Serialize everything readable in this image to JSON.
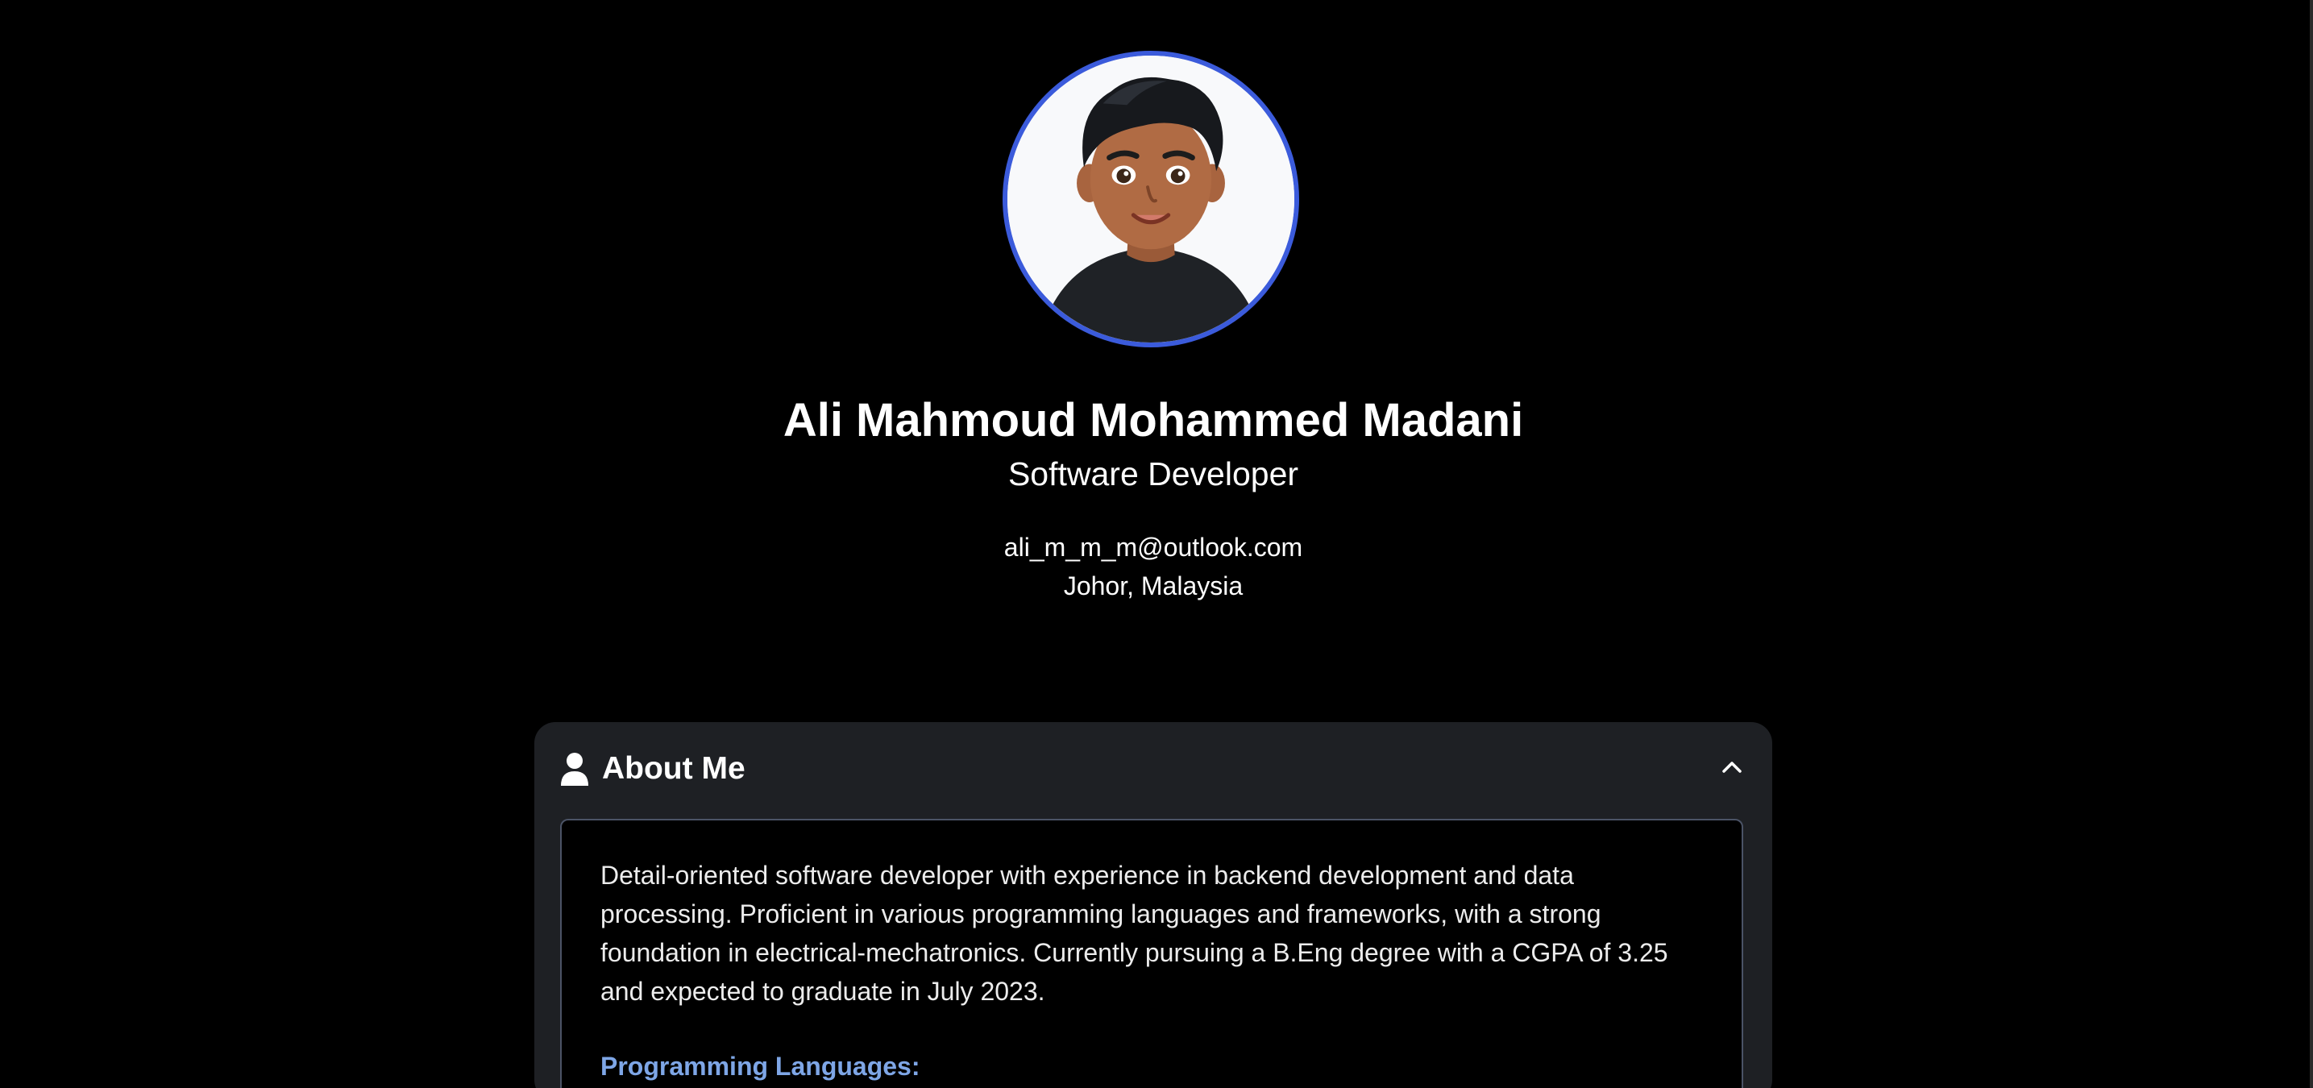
{
  "profile": {
    "name": "Ali Mahmoud Mohammed Madani",
    "title": "Software Developer",
    "email": "ali_m_m_m@outlook.com",
    "location": "Johor, Malaysia",
    "avatar_icon": "developer-avatar-illustration"
  },
  "about_card": {
    "title": "About Me",
    "header_icon": "person-icon",
    "toggle_icon": "chevron-up-icon",
    "expanded": true,
    "description": "Detail-oriented software developer with experience in backend development and data processing. Proficient in various programming languages and frameworks, with a strong foundation in electrical-mechatronics. Currently pursuing a B.Eng degree with a CGPA of 3.25 and expected to graduate in July 2023.",
    "section_heading": "Programming Languages:"
  },
  "colors": {
    "background": "#000000",
    "card_background": "#1e2024",
    "avatar_border": "#3b5bdb",
    "section_heading": "#7ea6e6"
  }
}
